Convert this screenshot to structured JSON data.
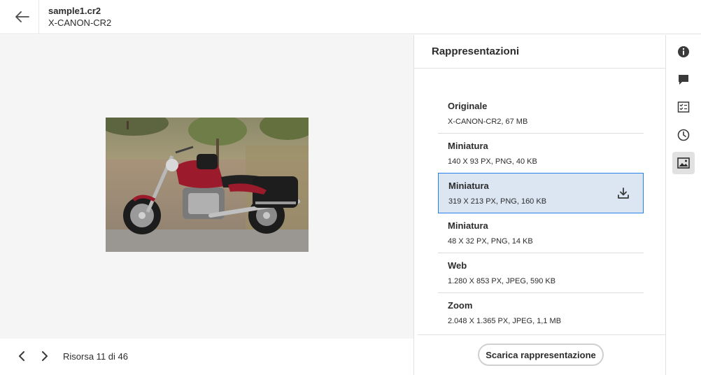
{
  "header": {
    "file_name": "sample1.cr2",
    "file_type": "X-CANON-CR2"
  },
  "preview": {
    "image_alt": "motorcycle photo"
  },
  "footer": {
    "counter": "Risorsa 11 di 46"
  },
  "panel": {
    "title": "Rappresentazioni",
    "renditions": [
      {
        "name": "Originale",
        "meta": "X-CANON-CR2, 67 MB"
      },
      {
        "name": "Miniatura",
        "meta": "140 X 93 PX, PNG, 40 KB"
      },
      {
        "name": "Miniatura",
        "meta": "319 X 213 PX, PNG, 160 KB",
        "selected": true
      },
      {
        "name": "Miniatura",
        "meta": "48 X 32 PX, PNG, 14 KB"
      },
      {
        "name": "Web",
        "meta": "1.280 X 853 PX, JPEG, 590 KB"
      },
      {
        "name": "Zoom",
        "meta": "2.048 X 1.365 PX, JPEG, 1,1 MB"
      }
    ],
    "download_button": "Scarica rappresentazione"
  },
  "rail": {
    "icons": [
      "info-icon",
      "comment-icon",
      "tasks-icon",
      "history-icon",
      "renditions-icon"
    ],
    "active": "renditions-icon"
  },
  "colors": {
    "selected_bg": "#dce6f2",
    "selected_border": "#2680eb",
    "preview_bg": "#f5f5f5",
    "motorcycle_red": "#9b1b2c"
  }
}
